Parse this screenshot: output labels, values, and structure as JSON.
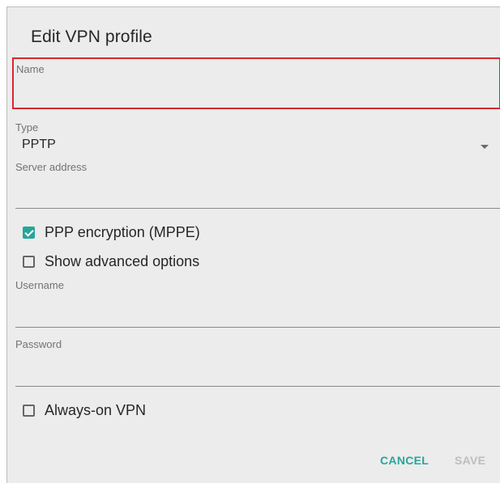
{
  "dialog": {
    "title": "Edit VPN profile"
  },
  "form": {
    "name": {
      "label": "Name",
      "value": ""
    },
    "type": {
      "label": "Type",
      "value": "PPTP"
    },
    "server_address": {
      "label": "Server address",
      "value": ""
    },
    "ppp_encryption": {
      "label": "PPP encryption (MPPE)",
      "checked": true
    },
    "show_advanced": {
      "label": "Show advanced options",
      "checked": false
    },
    "username": {
      "label": "Username",
      "value": ""
    },
    "password": {
      "label": "Password",
      "value": ""
    },
    "always_on": {
      "label": "Always-on VPN",
      "checked": false
    }
  },
  "buttons": {
    "cancel": "CANCEL",
    "save": "SAVE"
  },
  "colors": {
    "accent": "#26a69a",
    "highlight_border": "#d8282e",
    "disabled": "#bdbdbd",
    "background": "#ececec"
  },
  "icons": {
    "dropdown": "chevron-down-icon",
    "checkbox_checked": "checkbox-checked-icon",
    "checkbox_unchecked": "checkbox-unchecked-icon"
  }
}
